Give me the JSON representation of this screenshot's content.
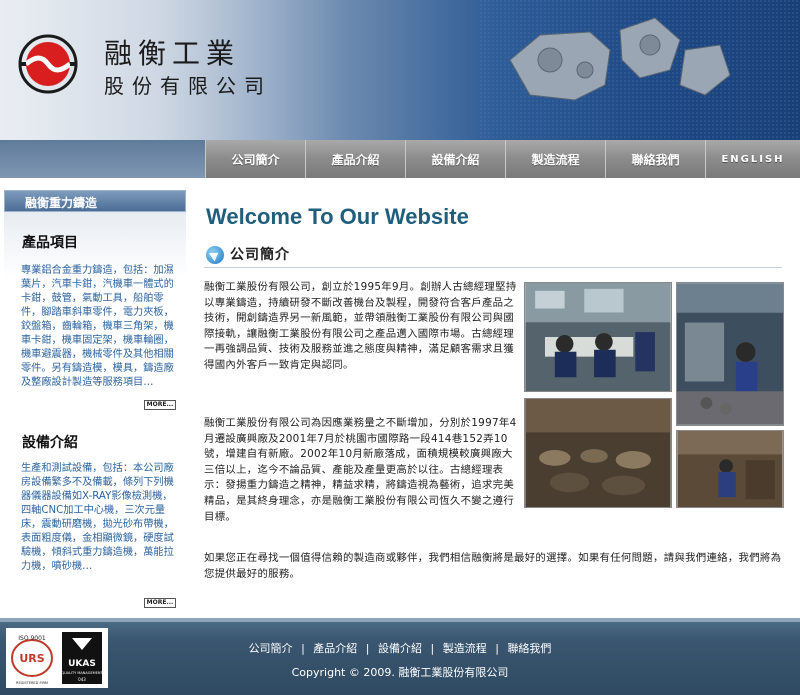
{
  "brand": {
    "name_line1": "融衡工業",
    "name_line2": "股份有限公司"
  },
  "nav": {
    "items": [
      {
        "label": "公司簡介"
      },
      {
        "label": "產品介紹"
      },
      {
        "label": "設備介紹"
      },
      {
        "label": "製造流程"
      },
      {
        "label": "聯絡我們"
      },
      {
        "label": "ENGLISH"
      }
    ]
  },
  "sidebar": {
    "tab_label": "融衡重力鑄造",
    "products": {
      "heading": "產品項目",
      "text": "專業鋁合金重力鑄造，包括：加濕葉片，汽車卡鉗，汽機車一體式的卡鉗，鼓管，氣動工具，船舶零件，腳踏車斜車零件，電力夾板，鉸盤箱，齒輪箱，機車三角架，機車卡鉗，機車固定架，機車輪圈，機車避震器，機械零件及其他相關零件。另有鑄造模，模具，鑄造廠及整廠設計製造等服務項目…",
      "more_label": "MORE..."
    },
    "equipment": {
      "heading": "設備介紹",
      "text": "生產和測試設備，包括：本公司廠房設備繁多不及備載，條列下列機器儀器設備如X-RAY影像檢測機，四軸CNC加工中心機，三次元量床，震動研磨機，拋光砂布帶機，表面粗度儀，金相顯微鏡，硬度試驗機，傾斜式重力鑄造機，萬能拉力機，噴砂機…",
      "more_label": "MORE..."
    }
  },
  "main": {
    "welcome": "Welcome To Our Website",
    "section_title": "公司簡介",
    "para1": "融衡工業股份有限公司，創立於1995年9月。創辦人古總經理堅持以專業鑄造，持續研發不斷改善機台及製程，開發符合客戶產品之技術，開創鑄造界另一新風範，並帶領融衡工業股份有限公司與國際接軌，讓融衡工業股份有限公司之產品邁入國際市場。古總經理一再強調品質、技術及服務並進之態度與精神，滿足顧客需求且獲得國內外客戶一致肯定與認同。",
    "para2": "融衡工業股份有限公司為因應業務量之不斷增加，分別於1997年4月遷設廣興廠及2001年7月於桃園市國際路一段414巷152弄10號，增建自有新廠。2002年10月新廠落成，面積規模較廣興廠大三倍以上，迄今不論品質、產能及產量更高於以往。古總經理表示：發揚重力鑄造之精神，精益求精，將鑄造視為藝術，追求完美精品，是其終身理念，亦是融衡工業股份有限公司恆久不變之遵行目標。",
    "para3": "如果您正在尋找一個值得信賴的製造商或夥伴，我們相信融衡將是最好的選擇。如果有任何問題，請與我們連絡，我們將為您提供最好的服務。"
  },
  "footer": {
    "links": [
      "公司簡介",
      "產品介紹",
      "設備介紹",
      "製造流程",
      "聯絡我們"
    ],
    "separator": "|",
    "copyright": "Copyright © 2009. 融衡工業股份有限公司",
    "cert": {
      "iso": "ISO 9001",
      "urs": "URS",
      "urs_sub": "REGISTERED FIRM",
      "ukas": "UKAS",
      "ukas_sub": "QUALITY MANAGEMENT",
      "ukas_num": "043"
    }
  },
  "colors": {
    "welcome": "#1f5f7c",
    "sidebar_text": "#2c64a0",
    "footer_bg": "#3a5670",
    "nav_button": "#8b8b8b"
  }
}
